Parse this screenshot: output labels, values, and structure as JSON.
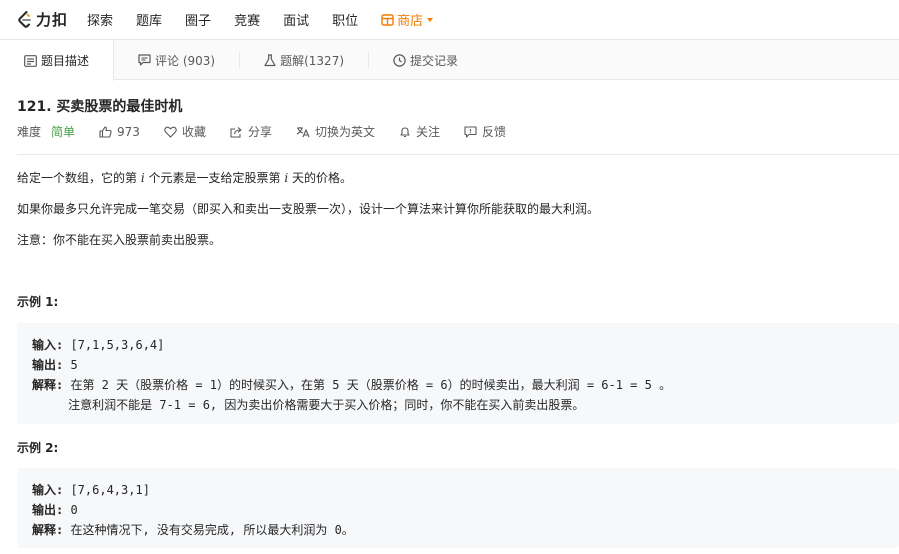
{
  "nav": {
    "logo_text": "力扣",
    "items": [
      "探索",
      "题库",
      "圈子",
      "竞赛",
      "面试",
      "职位"
    ],
    "store": "商店"
  },
  "tabs": [
    {
      "label": "题目描述",
      "icon": "description-icon"
    },
    {
      "label": "评论 (903)",
      "icon": "comment-icon"
    },
    {
      "label": "题解(1327)",
      "icon": "flask-icon"
    },
    {
      "label": "提交记录",
      "icon": "clock-icon"
    }
  ],
  "problem": {
    "title": "121. 买卖股票的最佳时机",
    "difficulty_label": "难度",
    "difficulty": "简单",
    "likes": "973",
    "favorite": "收藏",
    "share": "分享",
    "switch_lang": "切换为英文",
    "follow": "关注",
    "feedback": "反馈",
    "desc1_a": "给定一个数组，它的第 ",
    "desc1_i1": "i",
    "desc1_b": " 个元素是一支给定股票第 ",
    "desc1_i2": "i",
    "desc1_c": " 天的价格。",
    "desc2": "如果你最多只允许完成一笔交易（即买入和卖出一支股票一次），设计一个算法来计算你所能获取的最大利润。",
    "desc3": "注意：你不能在买入股票前卖出股票。"
  },
  "examples": [
    {
      "title": "示例 1:",
      "input_label": "输入:",
      "input": " [7,1,5,3,6,4]",
      "output_label": "输出:",
      "output": " 5",
      "explain_label": "解释:",
      "explain": " 在第 2 天（股票价格 = 1）的时候买入，在第 5 天（股票价格 = 6）的时候卖出，最大利润 = 6-1 = 5 。",
      "explain2": "     注意利润不能是 7-1 = 6, 因为卖出价格需要大于买入价格；同时，你不能在买入前卖出股票。"
    },
    {
      "title": "示例 2:",
      "input_label": "输入:",
      "input": " [7,6,4,3,1]",
      "output_label": "输出:",
      "output": " 0",
      "explain_label": "解释:",
      "explain": " 在这种情况下, 没有交易完成, 所以最大利润为 0。"
    }
  ],
  "colors": {
    "accent_store": "#f57c00",
    "easy": "#43a047"
  }
}
